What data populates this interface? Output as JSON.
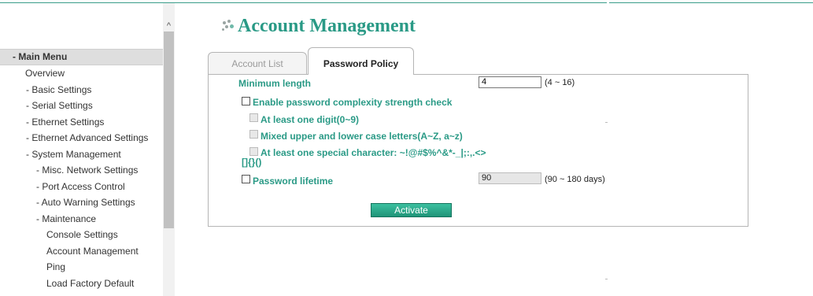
{
  "menu": {
    "header": "- Main Menu",
    "items": [
      {
        "label": "Overview",
        "level": 1
      },
      {
        "label": "- Basic Settings",
        "level": 1
      },
      {
        "label": "- Serial Settings",
        "level": 1
      },
      {
        "label": "- Ethernet Settings",
        "level": 1
      },
      {
        "label": "- Ethernet Advanced Settings",
        "level": 1
      },
      {
        "label": "- System Management",
        "level": 1
      },
      {
        "label": "- Misc. Network Settings",
        "level": 2
      },
      {
        "label": "- Port Access Control",
        "level": 2
      },
      {
        "label": "- Auto Warning Settings",
        "level": 2
      },
      {
        "label": "- Maintenance",
        "level": 2
      },
      {
        "label": "Console Settings",
        "level": 3
      },
      {
        "label": "Account Management",
        "level": 3
      },
      {
        "label": "Ping",
        "level": 3
      },
      {
        "label": "Load Factory Default",
        "level": 3
      }
    ]
  },
  "scrollbar": {
    "up_arrow": "^"
  },
  "page": {
    "title": "Account Management"
  },
  "tabs": {
    "account_list": "Account List",
    "password_policy": "Password Policy",
    "active": "Password Policy"
  },
  "form": {
    "min_length_label": "Minimum length",
    "min_length_value": "4",
    "min_length_range": "(4 ~ 16)",
    "complexity_label": "Enable password complexity strength check",
    "complexity_checked": false,
    "digit_label": "At least one digit(0~9)",
    "case_label": "Mixed upper and lower case letters(A~Z, a~z)",
    "special_label_line1": "At least one special character: ~!@#$%^&*-_|;:,.<>",
    "special_label_line2": "[]{}()",
    "lifetime_label": "Password lifetime",
    "lifetime_checked": false,
    "lifetime_value": "90",
    "lifetime_range": "(90 ~ 180 days)"
  },
  "buttons": {
    "activate": "Activate"
  },
  "colors": {
    "accent": "#2a9a86",
    "button": "#1f9478"
  }
}
